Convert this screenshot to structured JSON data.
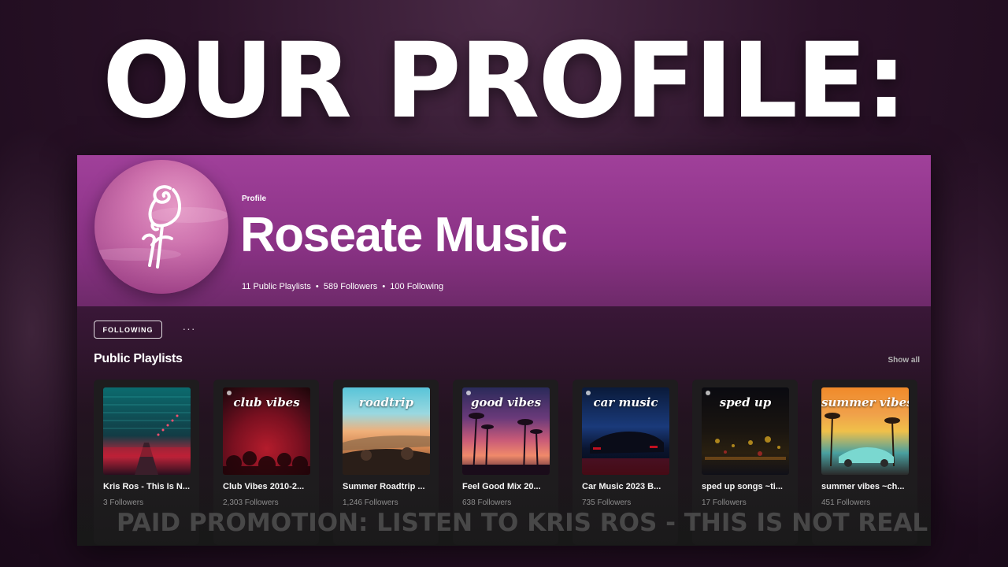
{
  "overlay": {
    "headline": "OUR PROFILE:",
    "promo": "PAID PROMOTION: LISTEN TO KRIS ROS - THIS IS NOT REAL"
  },
  "profile": {
    "kind": "Profile",
    "name": "Roseate Music",
    "public_playlists": "11 Public Playlists",
    "followers": "589 Followers",
    "following": "100 Following",
    "separator": "•"
  },
  "actions": {
    "follow_label": "FOLLOWING",
    "more_label": "···"
  },
  "section": {
    "title": "Public Playlists",
    "show_all": "Show all"
  },
  "playlists": [
    {
      "title": "Kris Ros - This Is N...",
      "followers": "3 Followers",
      "cover_text": "",
      "colors": [
        "#0b6b6e",
        "#123c45",
        "#c4243b",
        "#2a0f1e"
      ]
    },
    {
      "title": "Club Vibes 2010-2...",
      "followers": "2,303 Followers",
      "cover_text": "club vibes",
      "colors": [
        "#3a0a14",
        "#7a1020",
        "#b41c2c",
        "#1c0508"
      ]
    },
    {
      "title": "Summer Roadtrip ...",
      "followers": "1,246 Followers",
      "cover_text": "roadtrip",
      "colors": [
        "#58c4d8",
        "#f0b07a",
        "#d08450",
        "#3a2a20"
      ]
    },
    {
      "title": "Feel Good Mix 20...",
      "followers": "638 Followers",
      "cover_text": "good vibes",
      "colors": [
        "#2a2a5a",
        "#c85a78",
        "#f08a6a",
        "#3a1830"
      ]
    },
    {
      "title": "Car Music 2023 B...",
      "followers": "735 Followers",
      "cover_text": "car music",
      "colors": [
        "#0a1a3a",
        "#1a3a7a",
        "#c01020",
        "#050810"
      ]
    },
    {
      "title": "sped up songs ~ti...",
      "followers": "17 Followers",
      "cover_text": "sped up",
      "colors": [
        "#0a0a10",
        "#2a2010",
        "#d0a020",
        "#101018"
      ]
    },
    {
      "title": "summer vibes ~ch...",
      "followers": "451 Followers",
      "cover_text": "summer vibes",
      "colors": [
        "#f08a2a",
        "#f0c04a",
        "#4aa0a0",
        "#2a2a2a"
      ]
    }
  ]
}
